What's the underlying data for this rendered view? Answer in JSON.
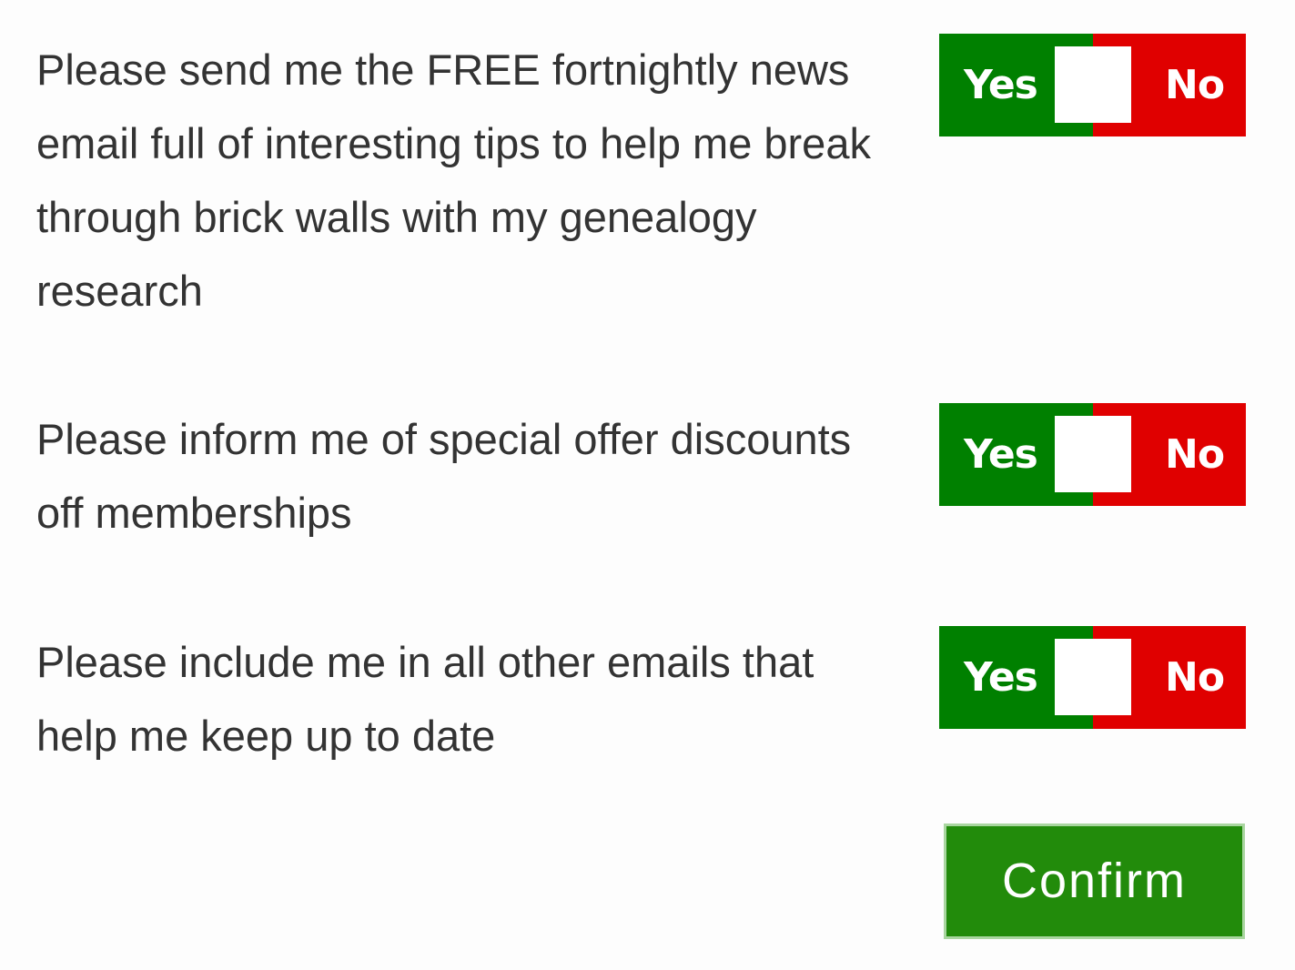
{
  "colors": {
    "yes_green": "#008000",
    "no_red": "#e00000",
    "confirm_green": "#228b0b",
    "text": "#333333"
  },
  "preferences": [
    {
      "text": "Please send me the FREE fortnightly news email full of interesting tips to help me break through brick walls with my genealogy research",
      "yes_label": "Yes",
      "no_label": "No"
    },
    {
      "text": "Please inform me of special offer discounts off memberships",
      "yes_label": "Yes",
      "no_label": "No"
    },
    {
      "text": "Please include me in all other emails that help me keep up to date",
      "yes_label": "Yes",
      "no_label": "No"
    }
  ],
  "confirm_label": "Confirm"
}
